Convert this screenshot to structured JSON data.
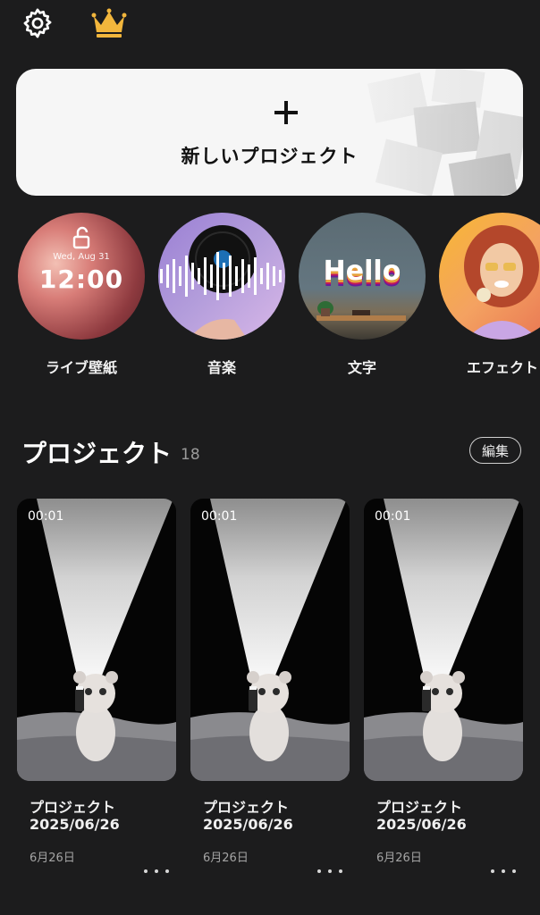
{
  "top_bar": {
    "settings_icon": "gear-icon",
    "premium_icon": "crown-icon"
  },
  "new_project": {
    "icon": "plus-icon",
    "label": "新しいプロジェクト"
  },
  "features": [
    {
      "label": "ライブ壁紙",
      "date_text": "Wed, Aug 31",
      "time_text": "12:00"
    },
    {
      "label": "音楽"
    },
    {
      "label": "文字",
      "sample_text": "Hello"
    },
    {
      "label": "エフェクト"
    }
  ],
  "projects_header": {
    "title": "プロジェクト",
    "count": "18",
    "edit_label": "編集"
  },
  "projects": [
    {
      "duration": "00:01",
      "name": "プロジェクト",
      "date": "2025/06/26",
      "modified": "6月26日"
    },
    {
      "duration": "00:01",
      "name": "プロジェクト",
      "date": "2025/06/26",
      "modified": "6月26日"
    },
    {
      "duration": "00:01",
      "name": "プロジェクト",
      "date": "2025/06/26",
      "modified": "6月26日"
    }
  ],
  "colors": {
    "background": "#1c1c1d",
    "card": "#f6f6f6",
    "crown": "#f2b63c"
  }
}
